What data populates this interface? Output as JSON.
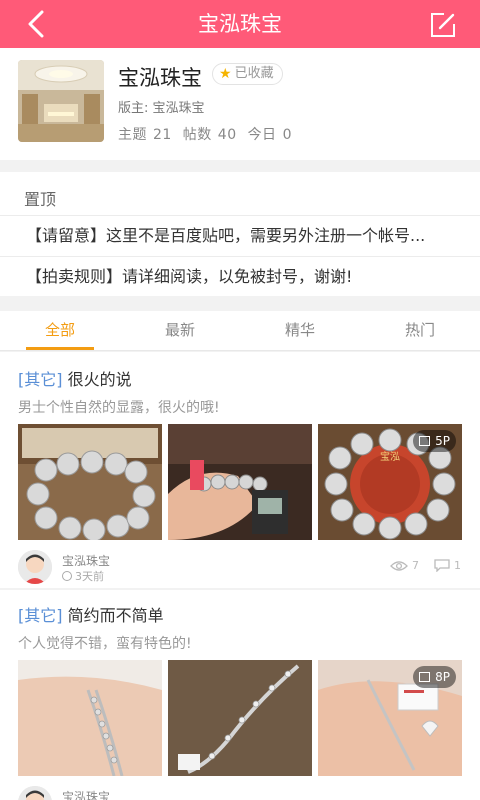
{
  "header": {
    "title": "宝泓珠宝",
    "back_icon": "back-chevron-icon",
    "edit_icon": "edit-post-icon"
  },
  "forum": {
    "name": "宝泓珠宝",
    "favorite_label": "已收藏",
    "moderator_label": "版主:",
    "moderator_name": "宝泓珠宝",
    "topics_label": "主题",
    "topics": "21",
    "posts_label": "帖数",
    "posts": "40",
    "today_label": "今日",
    "today": "0"
  },
  "pinned": {
    "heading": "置顶",
    "items": [
      {
        "text": "【请留意】这里不是百度贴吧，需要另外注册一个帐号..."
      },
      {
        "text": "【拍卖规则】请详细阅读，以免被封号，谢谢!"
      }
    ]
  },
  "tabs": [
    {
      "label": "全部",
      "active": true
    },
    {
      "label": "最新",
      "active": false
    },
    {
      "label": "精华",
      "active": false
    },
    {
      "label": "热门",
      "active": false
    }
  ],
  "posts": [
    {
      "category": "[其它]",
      "title": "很火的说",
      "desc": "男士个性自然的显露，很火的哦!",
      "photo_count": "5P",
      "author": "宝泓珠宝",
      "time": "3天前",
      "views": "7",
      "comments": "1"
    },
    {
      "category": "[其它]",
      "title": "简约而不简单",
      "desc": "个人觉得不错，蛮有特色的!",
      "photo_count": "8P",
      "author": "宝泓珠宝"
    }
  ],
  "colors": {
    "header_bg": "#ff5a78",
    "tab_active": "#f39c12",
    "category": "#5a8fd6"
  }
}
